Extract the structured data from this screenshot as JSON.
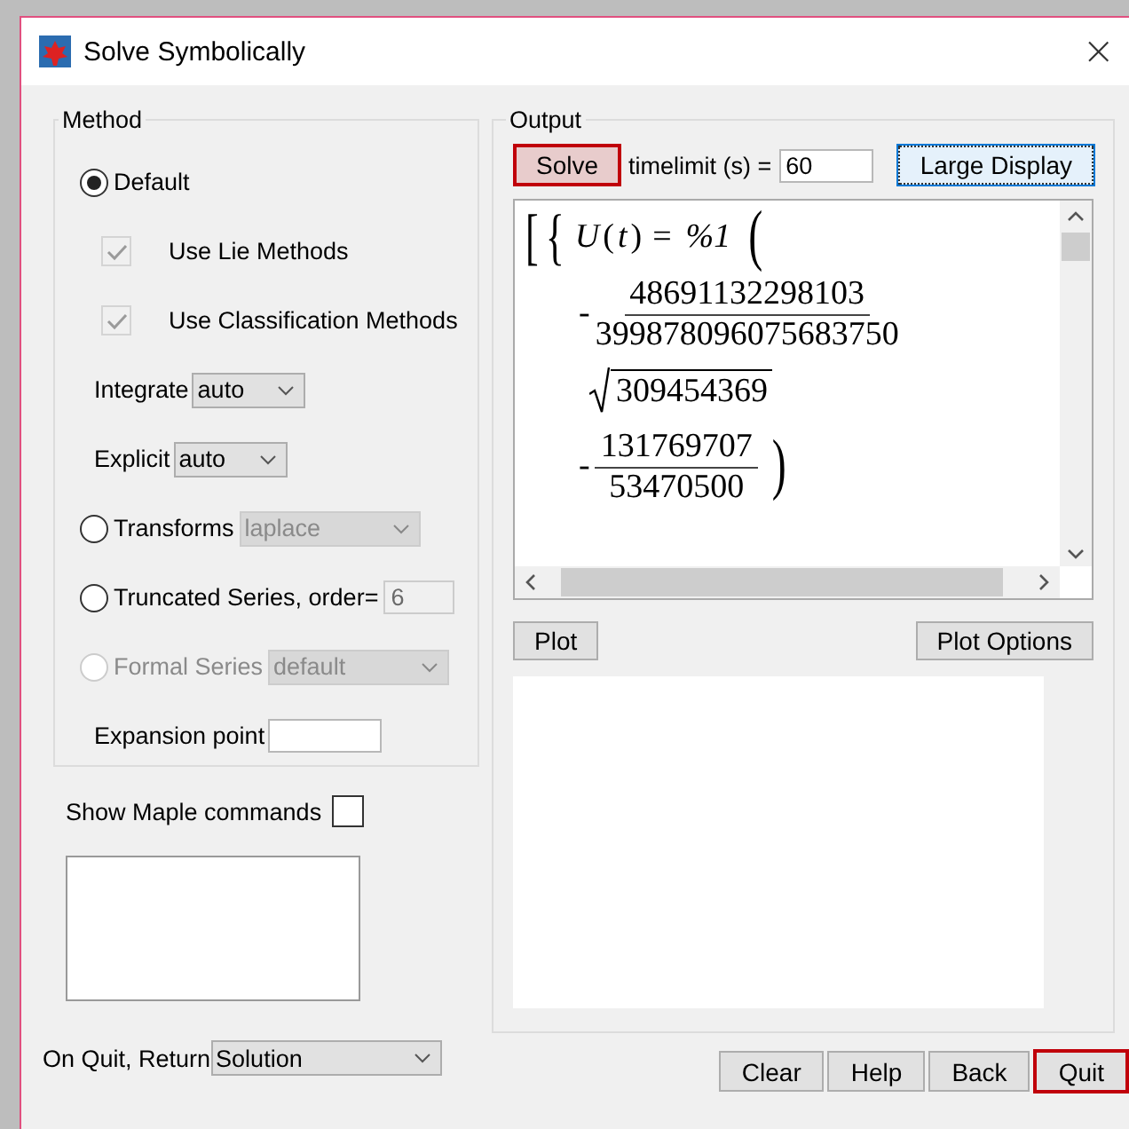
{
  "window": {
    "title": "Solve Symbolically",
    "close": "×"
  },
  "method": {
    "title": "Method",
    "items": [
      {
        "kind": "radio",
        "label": "Default",
        "selected": true,
        "disabled": false
      },
      {
        "kind": "checkbox",
        "label": "Use Lie Methods",
        "checked": true,
        "disabled": true
      },
      {
        "kind": "checkbox",
        "label": "Use Classification Methods",
        "checked": true,
        "disabled": true
      },
      {
        "kind": "select",
        "label": "Integrate",
        "value": "auto",
        "disabled": false
      },
      {
        "kind": "select",
        "label": "Explicit",
        "value": "auto",
        "disabled": false
      },
      {
        "kind": "radio",
        "label": "Transforms",
        "selected": false,
        "disabled": false,
        "select": {
          "value": "laplace",
          "disabled": true
        }
      },
      {
        "kind": "radio",
        "label": "Truncated Series, order=",
        "selected": false,
        "disabled": false,
        "input": {
          "value": "6",
          "disabled": true
        }
      },
      {
        "kind": "radio",
        "label": "Formal Series",
        "selected": false,
        "disabled": true,
        "select": {
          "value": "default",
          "disabled": true
        }
      },
      {
        "kind": "field",
        "label": "Expansion point",
        "disabled": false
      }
    ]
  },
  "show_commands": {
    "label": "Show Maple commands",
    "checked": false
  },
  "on_quit": {
    "label": "On Quit, Return",
    "value": "Solution"
  },
  "output": {
    "title": "Output",
    "solve": {
      "label": "Solve",
      "highlighted": true
    },
    "timelimit": {
      "label": "timelimit (s) =",
      "value": "60"
    },
    "large_display": {
      "label": "Large Display",
      "focused": true
    },
    "math": {
      "open": "[",
      "brace": "{",
      "lhs": "U",
      "paren_open": "(",
      "arg": "t",
      "paren_close": ")",
      "equals": "=",
      "rhs": "%1",
      "group_open": "(",
      "fraction1": {
        "sign": "-",
        "numerator": "48691132298103",
        "denominator": "399878096075683750"
      },
      "sqrt": "309454369",
      "fraction2": {
        "sign": "-",
        "numerator": "131769707",
        "denominator": "53470500"
      },
      "group_close": ")"
    },
    "plot": {
      "label": "Plot"
    },
    "plot_options": {
      "label": "Plot Options"
    }
  },
  "buttons": [
    {
      "label": "Clear",
      "highlighted": false
    },
    {
      "label": "Help",
      "highlighted": false
    },
    {
      "label": "Back",
      "highlighted": false
    },
    {
      "label": "Quit",
      "highlighted": true
    }
  ]
}
